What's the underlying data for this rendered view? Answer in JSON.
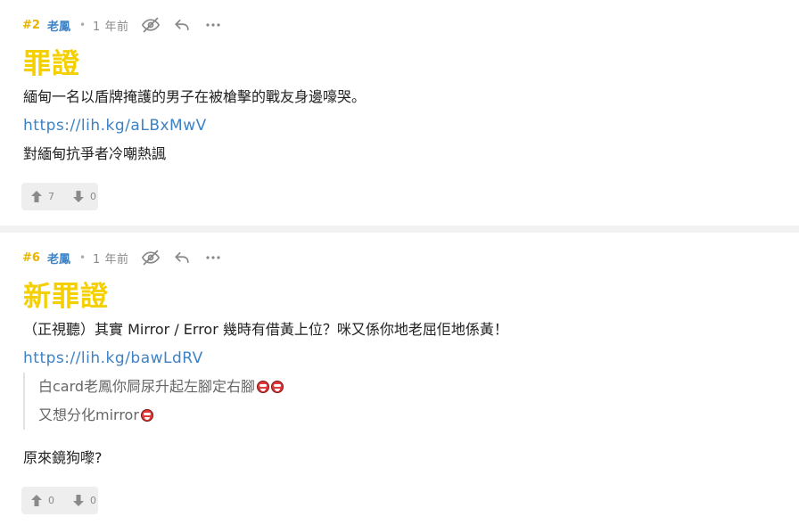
{
  "posts": [
    {
      "floor": "#2",
      "user": "老鳳",
      "time": "1 年前",
      "heading": "罪證",
      "text1": "緬甸一名以盾牌掩護的男子在被槍擊的戰友身邊嚎哭。",
      "link": "https://lih.kg/aLBxMwV",
      "text2": "對緬甸抗爭者冷嘲熱諷",
      "upvotes": "7",
      "downvotes": "0"
    },
    {
      "floor": "#6",
      "user": "老鳳",
      "time": "1 年前",
      "heading": "新罪證",
      "text1": "（正視聽）其實 Mirror / Error 幾時有借黃上位？咪又係你地老屈佢地係黃！",
      "link": "https://lih.kg/bawLdRV",
      "quote1": "白card老鳳你屙尿升起左腳定右腳",
      "quote2": "又想分化mirror",
      "text2": "原來鏡狗嚟?",
      "upvotes": "0",
      "downvotes": "0"
    }
  ],
  "icons": {
    "hide": "eye-off-icon",
    "reply": "reply-icon",
    "more": "more-icon",
    "up": "arrow-up-icon",
    "down": "arrow-down-icon",
    "emoticon": "emoticon-icon"
  }
}
